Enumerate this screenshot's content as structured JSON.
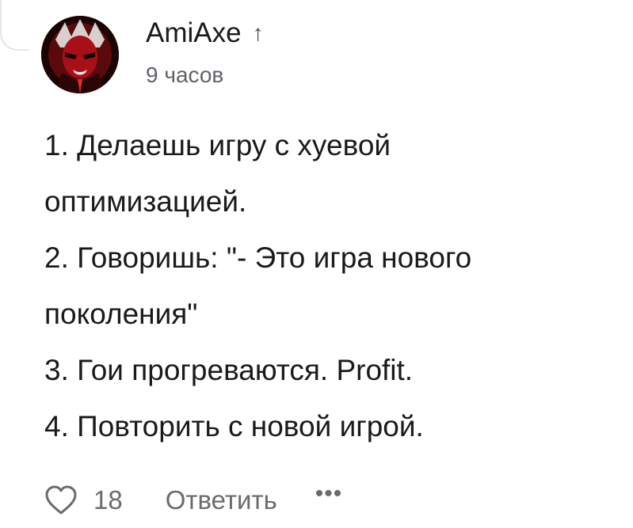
{
  "comment": {
    "author": "AmiAxe",
    "time": "9 часов",
    "lines": [
      "1. Делаешь игру с хуевой",
      "оптимизацией.",
      "2. Говоришь: \"- Это игра нового",
      "поколения\"",
      "3. Гои прогреваются. Profit.",
      "4. Повторить с новой игрой."
    ],
    "author_arrow_icon": "arrow-up-icon",
    "avatar_icon": "avatar-red-face"
  },
  "actions": {
    "likes_count": "18",
    "reply_label": "Ответить",
    "more_label": "•••",
    "like_icon": "heart-outline-icon"
  },
  "colors": {
    "text": "#1a1a1b",
    "secondary_text": "#5f6368",
    "avatar_red": "#c0101a"
  }
}
